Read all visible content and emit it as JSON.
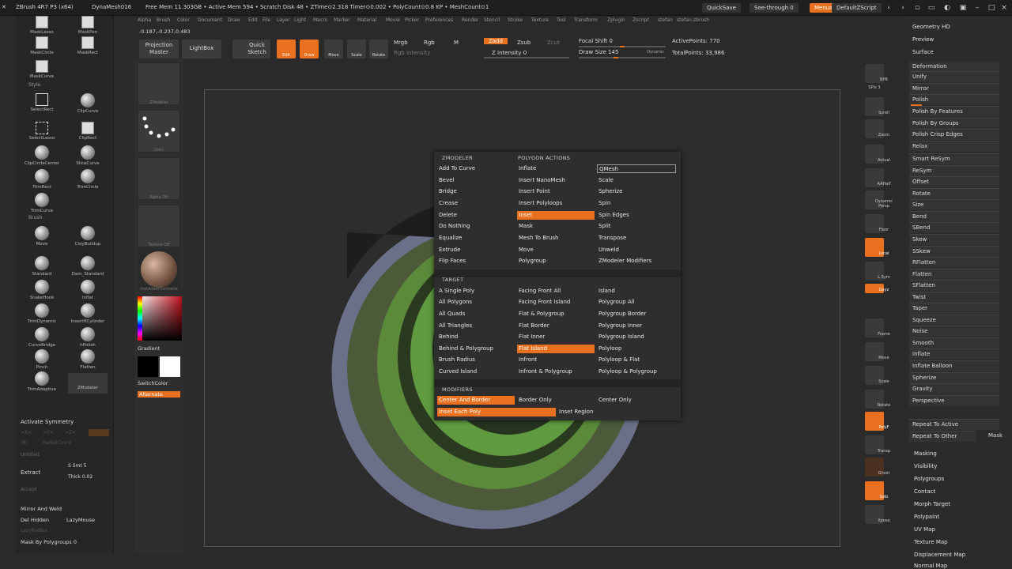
{
  "titlebar": {
    "app": "ZBrush 4R7 P3 (x64)",
    "mesh": "DynaMesh016",
    "stats": "Free Mem 11.303GB • Active Mem 594 • Scratch Disk 48 • ZTime⊙2.318 Timer⊙0.002 • PolyCount⊙0.8 KP • MeshCount⊙1",
    "quicksave": "QuickSave",
    "seethrough": "See-through  0",
    "menus": "Menus",
    "script": "DefaultZScript"
  },
  "coords": "-0.187,-0.237,0.483",
  "menubar": [
    "Alpha",
    "Brush",
    "Color",
    "Document",
    "Draw",
    "Edit",
    "File",
    "Layer",
    "Light",
    "Macro",
    "Marker",
    "Material",
    "Movie",
    "Picker",
    "Preferences",
    "Render",
    "Stencil",
    "Stroke",
    "Texture",
    "Tool",
    "Transform",
    "Zplugin",
    "Zscript",
    "stefan",
    "stefan-zbrush"
  ],
  "toolbar": {
    "projection_master": "Projection Master",
    "lightbox": "LightBox",
    "quick_sketch": "Quick Sketch",
    "edit": "Edit",
    "draw": "Draw",
    "move": "Move",
    "scale": "Scale",
    "rotate": "Rotate",
    "mrgb": "Mrgb",
    "rgb": "Rgb",
    "m": "M",
    "rgb_intensity": "Rgb Intensity",
    "zadd": "Zadd",
    "zsub": "Zsub",
    "zcut": "Zcut",
    "z_intensity": "Z Intensity 0",
    "focal_shift": "Focal Shift 0",
    "draw_size": "Draw Size 145",
    "dynamic": "Dynamic",
    "active_points": "ActivePoints: 770",
    "total_points": "TotalPoints: 33,986"
  },
  "left": {
    "brushes": [
      {
        "name": "MaskLasso"
      },
      {
        "name": "MaskPen"
      },
      {
        "name": "MaskCircle"
      },
      {
        "name": "MaskRect"
      },
      {
        "name": "MaskCurve"
      }
    ],
    "style_label": "Style",
    "select": [
      {
        "name": "SelectRect"
      },
      {
        "name": "ClipCurve"
      },
      {
        "name": "SelectLasso"
      },
      {
        "name": "ClipRect"
      },
      {
        "name": "ClipCircleCenter"
      },
      {
        "name": "SliceCurve"
      },
      {
        "name": "TrimRect"
      },
      {
        "name": "TrimCircle"
      },
      {
        "name": "TrimCurve"
      }
    ],
    "brush_label": "Brush",
    "brush_list": [
      {
        "name": "Move"
      },
      {
        "name": "ClayBuildup"
      },
      {
        "name": "Standard"
      },
      {
        "name": "Dam_Standard"
      },
      {
        "name": "SnakeHook"
      },
      {
        "name": "Inflat"
      },
      {
        "name": "TrimDynamic"
      },
      {
        "name": "InsertHCylinder"
      },
      {
        "name": "CurveBridge"
      },
      {
        "name": "hPolish"
      },
      {
        "name": "Pinch"
      },
      {
        "name": "Flatten"
      },
      {
        "name": "TrimAdaptive"
      },
      {
        "name": "ZModeler"
      }
    ],
    "activate_symmetry": "Activate Symmetry",
    "sym_x": ">X<",
    "sym_y": ">Y<",
    "sym_z": ">Z<",
    "radial": "RadialCount",
    "r_label": "(R)",
    "untitled": "Untitled",
    "extract": "Extract",
    "smt": "S Smt 5",
    "thick": "Thick 0.02",
    "accept": "Accept",
    "mirror_weld": "Mirror And Weld",
    "del_hidden": "Del Hidden",
    "lazymouse": "LazyMouse",
    "lazyradius": "LazyRadius",
    "mask_polygroups": "Mask By Polygroups 0"
  },
  "col2": {
    "zmodeler": "ZModeler",
    "dots": "Dots",
    "alpha_off": "Alpha Off",
    "texture_off": "Texture Off",
    "material": "matAdamTurntable",
    "gradient": "Gradient",
    "switchcolor": "SwitchColor",
    "alternate": "Alternate"
  },
  "rightshelf": [
    "BPR",
    "SPix 3",
    "Scroll",
    "Zoom",
    "Actual",
    "AAHalf",
    "Dynamic Persp",
    "Floor",
    "Local",
    "L.Sym",
    "Gxyz",
    "Frame",
    "Move",
    "Scale",
    "Rotate",
    "PolyF",
    "Transp",
    "Ghost",
    "Solo",
    "Xpose"
  ],
  "rightpanel": {
    "top": [
      "Geometry HD",
      "Preview",
      "Surface"
    ],
    "deformation": "Deformation",
    "items": [
      "Unify",
      "Mirror",
      "Polish",
      "Polish By Features",
      "Polish By Groups",
      "Polish Crisp Edges",
      "Relax",
      "Smart ReSym",
      "ReSym",
      "Offset",
      "Rotate",
      "Size",
      "Bend",
      "SBend",
      "Skew",
      "SSkew",
      "RFlatten",
      "Flatten",
      "SFlatten",
      "Twist",
      "Taper",
      "Squeeze",
      "Noise",
      "Smooth",
      "Inflate",
      "Inflate Balloon",
      "Spherize",
      "Gravity",
      "Perspective"
    ],
    "repeat_active": "Repeat To Active",
    "repeat_other": "Repeat To Other",
    "mask": "Mask",
    "sub": [
      "Masking",
      "Visibility",
      "Polygroups",
      "Contact",
      "Morph Target",
      "Polypaint",
      "UV Map",
      "Texture Map",
      "Displacement Map",
      "Normal Map"
    ]
  },
  "popup": {
    "zmodeler_head": "ZMODELER",
    "polygon_actions_head": "POLYGON ACTIONS",
    "col1": [
      "Add To Curve",
      "Bevel",
      "Bridge",
      "Crease",
      "Delete",
      "Do Nothing",
      "Equalize",
      "Extrude",
      "Flip Faces"
    ],
    "col2": [
      "Inflate",
      "Insert NanoMesh",
      "Insert Point",
      "Insert Polyloops",
      "Inset",
      "Mask",
      "Mesh To Brush",
      "Move",
      "Polygroup"
    ],
    "col3": [
      "QMesh",
      "Scale",
      "Spherize",
      "Spin",
      "Spin Edges",
      "Split",
      "Transpose",
      "Unweld",
      "ZModeler Modifiers"
    ],
    "target_head": "TARGET",
    "t1": [
      "A Single Poly",
      "All Polygons",
      "All Quads",
      "All Triangles",
      "Behind",
      "Behind & Polygroup",
      "Brush Radius",
      "Curved Island"
    ],
    "t2": [
      "Facing Front All",
      "Facing Front Island",
      "Flat & Polygroup",
      "Flat Border",
      "Flat Inner",
      "Flat Island",
      "Infront",
      "Infront & Polygroup"
    ],
    "t3": [
      "Island",
      "Polygroup All",
      "Polygroup Border",
      "Polygroup Inner",
      "Polygroup Island",
      "Polyloop",
      "Polyloop & Flat",
      "Polyloop & Polygroup"
    ],
    "modifiers_head": "MODIFIERS",
    "m1": [
      "Center And Border",
      "Border Only",
      "Center Only"
    ],
    "m2": [
      "Inset Each Poly",
      "Inset Region"
    ]
  }
}
